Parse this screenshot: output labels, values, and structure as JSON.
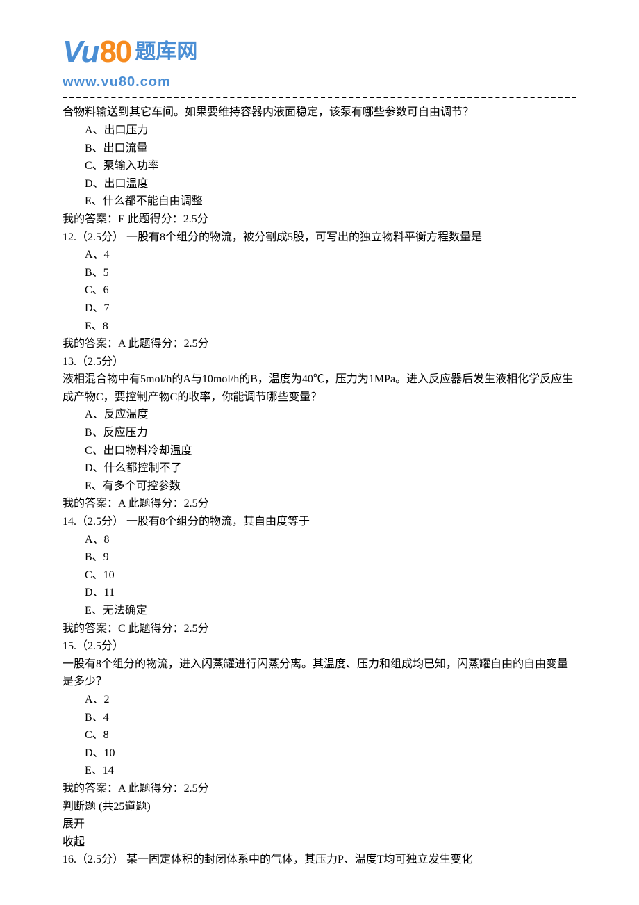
{
  "logo": {
    "vu": "Vu",
    "eighty": "80",
    "text": "题库网",
    "url": "www.vu80.com"
  },
  "q11": {
    "cont": "合物料输送到其它车间。如果要维持容器内液面稳定，该泵有哪些参数可自由调节？",
    "A": "A、出口压力",
    "B": "B、出口流量",
    "C": "C、泵输入功率",
    "D": "D、出口温度",
    "E": "E、什么都不能自由调整",
    "answer": "我的答案：E 此题得分：2.5分"
  },
  "q12": {
    "prompt": "12.（2.5分） 一股有8个组分的物流，被分割成5股，可写出的独立物料平衡方程数量是",
    "A": "A、4",
    "B": "B、5",
    "C": "C、6",
    "D": "D、7",
    "E": "E、8",
    "answer": "我的答案：A 此题得分：2.5分"
  },
  "q13": {
    "header": "13.（2.5分）",
    "prompt": "液相混合物中有5mol/h的A与10mol/h的B，温度为40℃，压力为1MPa。进入反应器后发生液相化学反应生成产物C，要控制产物C的收率，你能调节哪些变量？",
    "A": "A、反应温度",
    "B": "B、反应压力",
    "C": "C、出口物料冷却温度",
    "D": "D、什么都控制不了",
    "E": "E、有多个可控参数",
    "answer": "我的答案：A 此题得分：2.5分"
  },
  "q14": {
    "prompt": "14.（2.5分） 一股有8个组分的物流，其自由度等于",
    "A": "A、8",
    "B": "B、9",
    "C": "C、10",
    "D": "D、11",
    "E": "E、无法确定",
    "answer": "我的答案：C 此题得分：2.5分"
  },
  "q15": {
    "header": "15.（2.5分）",
    "prompt": "一股有8个组分的物流，进入闪蒸罐进行闪蒸分离。其温度、压力和组成均已知，闪蒸罐自由的自由变量是多少？",
    "A": "A、2",
    "B": "B、4",
    "C": "C、8",
    "D": "D、10",
    "E": "E、14",
    "answer": "我的答案：A 此题得分：2.5分"
  },
  "judge": {
    "title": "判断题 (共25道题)",
    "expand": "展开",
    "collapse": "收起"
  },
  "q16": {
    "prompt": "16.（2.5分） 某一固定体积的封闭体系中的气体，其压力P、温度T均可独立发生变化"
  }
}
